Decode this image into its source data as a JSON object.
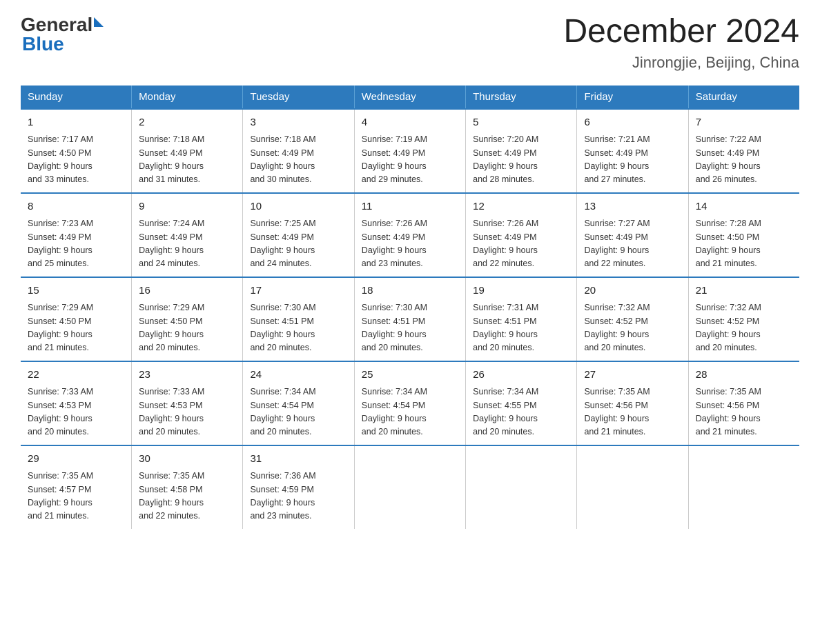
{
  "logo": {
    "text_general": "General",
    "text_blue": "Blue"
  },
  "title": "December 2024",
  "subtitle": "Jinrongjie, Beijing, China",
  "headers": [
    "Sunday",
    "Monday",
    "Tuesday",
    "Wednesday",
    "Thursday",
    "Friday",
    "Saturday"
  ],
  "weeks": [
    [
      {
        "day": "1",
        "info": "Sunrise: 7:17 AM\nSunset: 4:50 PM\nDaylight: 9 hours\nand 33 minutes."
      },
      {
        "day": "2",
        "info": "Sunrise: 7:18 AM\nSunset: 4:49 PM\nDaylight: 9 hours\nand 31 minutes."
      },
      {
        "day": "3",
        "info": "Sunrise: 7:18 AM\nSunset: 4:49 PM\nDaylight: 9 hours\nand 30 minutes."
      },
      {
        "day": "4",
        "info": "Sunrise: 7:19 AM\nSunset: 4:49 PM\nDaylight: 9 hours\nand 29 minutes."
      },
      {
        "day": "5",
        "info": "Sunrise: 7:20 AM\nSunset: 4:49 PM\nDaylight: 9 hours\nand 28 minutes."
      },
      {
        "day": "6",
        "info": "Sunrise: 7:21 AM\nSunset: 4:49 PM\nDaylight: 9 hours\nand 27 minutes."
      },
      {
        "day": "7",
        "info": "Sunrise: 7:22 AM\nSunset: 4:49 PM\nDaylight: 9 hours\nand 26 minutes."
      }
    ],
    [
      {
        "day": "8",
        "info": "Sunrise: 7:23 AM\nSunset: 4:49 PM\nDaylight: 9 hours\nand 25 minutes."
      },
      {
        "day": "9",
        "info": "Sunrise: 7:24 AM\nSunset: 4:49 PM\nDaylight: 9 hours\nand 24 minutes."
      },
      {
        "day": "10",
        "info": "Sunrise: 7:25 AM\nSunset: 4:49 PM\nDaylight: 9 hours\nand 24 minutes."
      },
      {
        "day": "11",
        "info": "Sunrise: 7:26 AM\nSunset: 4:49 PM\nDaylight: 9 hours\nand 23 minutes."
      },
      {
        "day": "12",
        "info": "Sunrise: 7:26 AM\nSunset: 4:49 PM\nDaylight: 9 hours\nand 22 minutes."
      },
      {
        "day": "13",
        "info": "Sunrise: 7:27 AM\nSunset: 4:49 PM\nDaylight: 9 hours\nand 22 minutes."
      },
      {
        "day": "14",
        "info": "Sunrise: 7:28 AM\nSunset: 4:50 PM\nDaylight: 9 hours\nand 21 minutes."
      }
    ],
    [
      {
        "day": "15",
        "info": "Sunrise: 7:29 AM\nSunset: 4:50 PM\nDaylight: 9 hours\nand 21 minutes."
      },
      {
        "day": "16",
        "info": "Sunrise: 7:29 AM\nSunset: 4:50 PM\nDaylight: 9 hours\nand 20 minutes."
      },
      {
        "day": "17",
        "info": "Sunrise: 7:30 AM\nSunset: 4:51 PM\nDaylight: 9 hours\nand 20 minutes."
      },
      {
        "day": "18",
        "info": "Sunrise: 7:30 AM\nSunset: 4:51 PM\nDaylight: 9 hours\nand 20 minutes."
      },
      {
        "day": "19",
        "info": "Sunrise: 7:31 AM\nSunset: 4:51 PM\nDaylight: 9 hours\nand 20 minutes."
      },
      {
        "day": "20",
        "info": "Sunrise: 7:32 AM\nSunset: 4:52 PM\nDaylight: 9 hours\nand 20 minutes."
      },
      {
        "day": "21",
        "info": "Sunrise: 7:32 AM\nSunset: 4:52 PM\nDaylight: 9 hours\nand 20 minutes."
      }
    ],
    [
      {
        "day": "22",
        "info": "Sunrise: 7:33 AM\nSunset: 4:53 PM\nDaylight: 9 hours\nand 20 minutes."
      },
      {
        "day": "23",
        "info": "Sunrise: 7:33 AM\nSunset: 4:53 PM\nDaylight: 9 hours\nand 20 minutes."
      },
      {
        "day": "24",
        "info": "Sunrise: 7:34 AM\nSunset: 4:54 PM\nDaylight: 9 hours\nand 20 minutes."
      },
      {
        "day": "25",
        "info": "Sunrise: 7:34 AM\nSunset: 4:54 PM\nDaylight: 9 hours\nand 20 minutes."
      },
      {
        "day": "26",
        "info": "Sunrise: 7:34 AM\nSunset: 4:55 PM\nDaylight: 9 hours\nand 20 minutes."
      },
      {
        "day": "27",
        "info": "Sunrise: 7:35 AM\nSunset: 4:56 PM\nDaylight: 9 hours\nand 21 minutes."
      },
      {
        "day": "28",
        "info": "Sunrise: 7:35 AM\nSunset: 4:56 PM\nDaylight: 9 hours\nand 21 minutes."
      }
    ],
    [
      {
        "day": "29",
        "info": "Sunrise: 7:35 AM\nSunset: 4:57 PM\nDaylight: 9 hours\nand 21 minutes."
      },
      {
        "day": "30",
        "info": "Sunrise: 7:35 AM\nSunset: 4:58 PM\nDaylight: 9 hours\nand 22 minutes."
      },
      {
        "day": "31",
        "info": "Sunrise: 7:36 AM\nSunset: 4:59 PM\nDaylight: 9 hours\nand 23 minutes."
      },
      {
        "day": "",
        "info": ""
      },
      {
        "day": "",
        "info": ""
      },
      {
        "day": "",
        "info": ""
      },
      {
        "day": "",
        "info": ""
      }
    ]
  ]
}
